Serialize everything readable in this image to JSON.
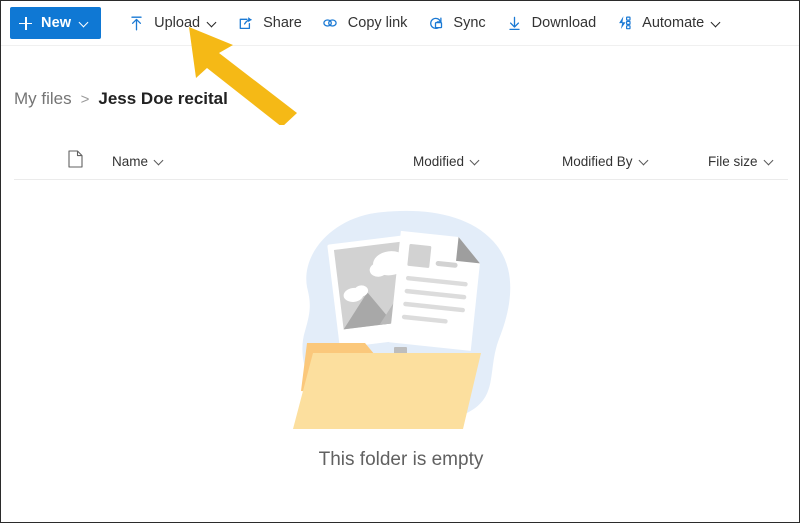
{
  "toolbar": {
    "new_button": {
      "label": "New",
      "icon": "plus-icon",
      "chevron": "chevron-down-icon",
      "color": "#0f78d4"
    },
    "items": [
      {
        "label": "Upload",
        "icon": "upload-icon",
        "has_chevron": true
      },
      {
        "label": "Share",
        "icon": "share-icon",
        "has_chevron": false
      },
      {
        "label": "Copy link",
        "icon": "copy-link-icon",
        "has_chevron": false
      },
      {
        "label": "Sync",
        "icon": "sync-icon",
        "has_chevron": false
      },
      {
        "label": "Download",
        "icon": "download-icon",
        "has_chevron": false
      },
      {
        "label": "Automate",
        "icon": "automate-icon",
        "has_chevron": true
      }
    ],
    "icon_color": "#1a79d4"
  },
  "breadcrumb": {
    "root": "My files",
    "separator": ">",
    "current": "Jess Doe recital"
  },
  "columns": {
    "file_type_icon": "document-icon",
    "name": "Name",
    "modified": "Modified",
    "modified_by": "Modified By",
    "file_size": "File size"
  },
  "empty_state": {
    "message": "This folder is empty",
    "illustration": "upload-to-folder-illustration",
    "blob_color": "#e3edf9",
    "folder_color": "#fbdf9a",
    "folder_back_color": "#fcc978"
  },
  "annotation": {
    "arrow": "pointer-arrow-icon",
    "color": "#f5b916",
    "points_to": "Upload"
  }
}
